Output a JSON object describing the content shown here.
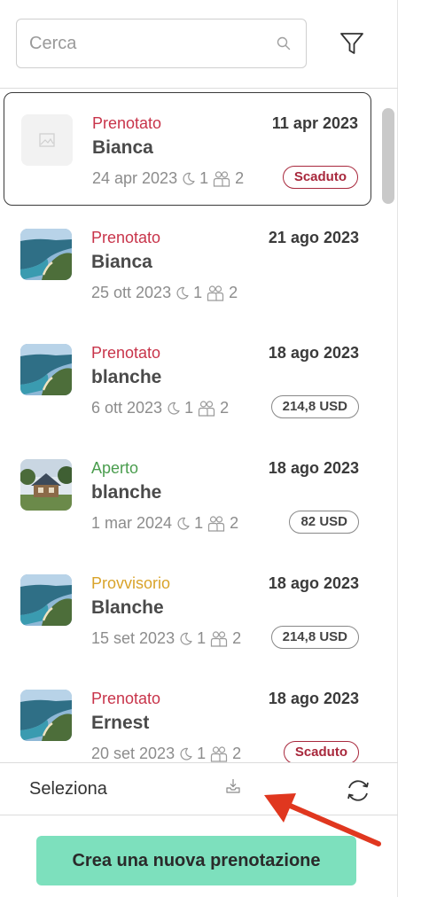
{
  "search": {
    "placeholder": "Cerca",
    "value": ""
  },
  "colors": {
    "prenotato": "#c8344a",
    "aperto": "#4a9d4e",
    "provvisorio": "#d9a32a",
    "expired": "#a8283c",
    "primary_button": "#7de0bd",
    "annotation_arrow": "#e0371f"
  },
  "bookings": [
    {
      "status": "Prenotato",
      "status_key": "prenotato",
      "date": "11 apr 2023",
      "name": "Bianca",
      "checkin": "24 apr 2023",
      "nights": "1",
      "guests": "2",
      "badge": "Scaduto",
      "badge_type": "expired",
      "image": "placeholder"
    },
    {
      "status": "Prenotato",
      "status_key": "prenotato",
      "date": "21 ago 2023",
      "name": "Bianca",
      "checkin": "25 ott 2023",
      "nights": "1",
      "guests": "2",
      "badge": "",
      "badge_type": "none",
      "image": "beach"
    },
    {
      "status": "Prenotato",
      "status_key": "prenotato",
      "date": "18 ago 2023",
      "name": "blanche",
      "checkin": "6 ott 2023",
      "nights": "1",
      "guests": "2",
      "badge": "214,8 USD",
      "badge_type": "price",
      "image": "beach"
    },
    {
      "status": "Aperto",
      "status_key": "aperto",
      "date": "18 ago 2023",
      "name": "blanche",
      "checkin": "1 mar 2024",
      "nights": "1",
      "guests": "2",
      "badge": "82 USD",
      "badge_type": "price",
      "image": "cabin"
    },
    {
      "status": "Provvisorio",
      "status_key": "provvisorio",
      "date": "18 ago 2023",
      "name": "Blanche",
      "checkin": "15 set 2023",
      "nights": "1",
      "guests": "2",
      "badge": "214,8 USD",
      "badge_type": "price",
      "image": "beach"
    },
    {
      "status": "Prenotato",
      "status_key": "prenotato",
      "date": "18 ago 2023",
      "name": "Ernest",
      "checkin": "20 set 2023",
      "nights": "1",
      "guests": "2",
      "badge": "Scaduto",
      "badge_type": "expired",
      "image": "beach"
    }
  ],
  "toolbar": {
    "select_label": "Seleziona",
    "download_icon": "download-tray-icon",
    "refresh_icon": "refresh-icon",
    "filter_icon": "filter-funnel-icon"
  },
  "actions": {
    "new_booking_label": "Crea una nuova prenotazione"
  }
}
